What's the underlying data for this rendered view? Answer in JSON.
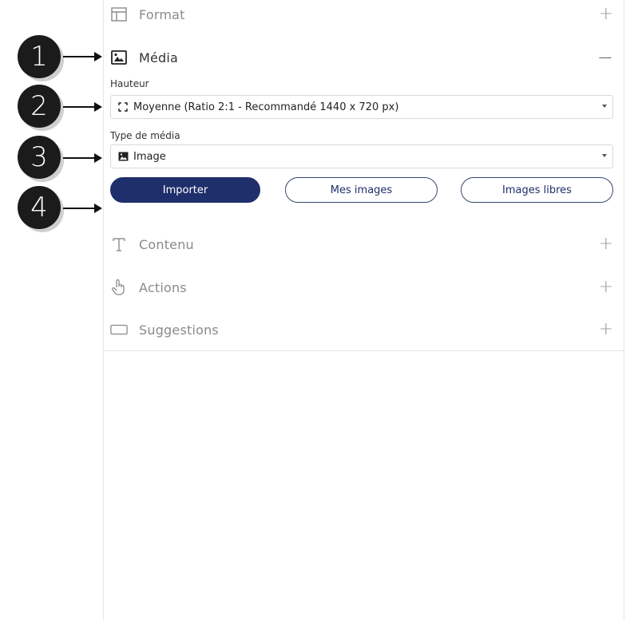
{
  "sections": {
    "format": {
      "label": "Format",
      "toggle": "+"
    },
    "media": {
      "label": "Média",
      "toggle": "−"
    },
    "contenu": {
      "label": "Contenu",
      "toggle": "+"
    },
    "actions": {
      "label": "Actions",
      "toggle": "+"
    },
    "suggestions": {
      "label": "Suggestions",
      "toggle": "+"
    }
  },
  "media_panel": {
    "hauteur_label": "Hauteur",
    "hauteur_value": "Moyenne (Ratio 2:1 - Recommandé 1440 x 720 px)",
    "type_label": "Type de média",
    "type_value": "Image",
    "buttons": {
      "importer": "Importer",
      "mes_images": "Mes images",
      "images_libres": "Images libres"
    }
  },
  "callouts": [
    "1",
    "2",
    "3",
    "4"
  ],
  "colors": {
    "primary": "#1f2f6b",
    "callout": "#1b1b1b"
  },
  "icons": {
    "format": "layout-icon",
    "media": "image-icon",
    "hauteur": "expand-icon",
    "type": "image-icon",
    "contenu": "text-icon",
    "actions": "pointer-hand-icon",
    "suggestions": "rectangle-icon"
  }
}
